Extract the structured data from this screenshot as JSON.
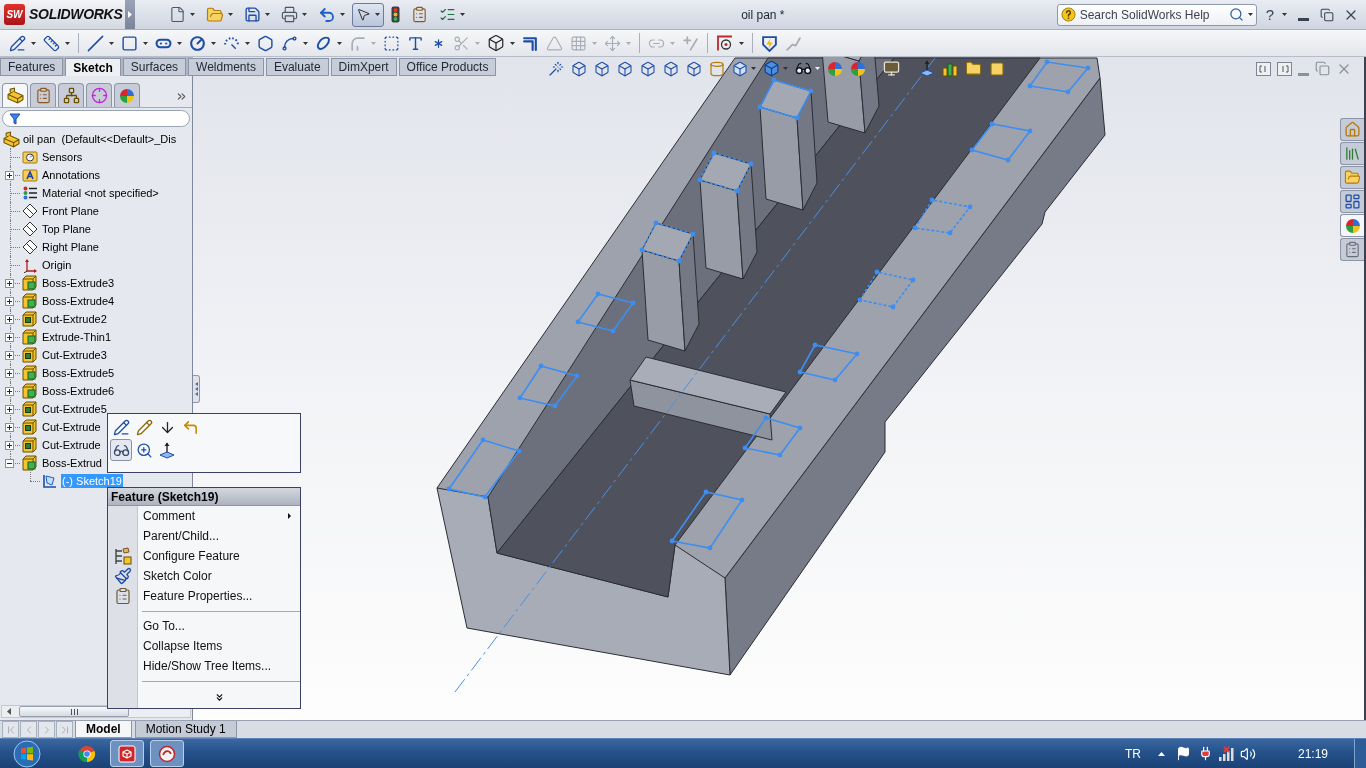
{
  "app": {
    "logo_badge": "SW",
    "logo_text": "SOLIDWORKS",
    "title": "oil pan *",
    "help_button": "?"
  },
  "quick_access": [
    {
      "menu": true,
      "pressed": false
    },
    {
      "menu": true,
      "pressed": false
    },
    {
      "menu": true,
      "pressed": false
    },
    {
      "menu": true,
      "pressed": false
    },
    {
      "menu": true,
      "pressed": false
    },
    {
      "menu": true,
      "pressed": true
    },
    {
      "menu": false,
      "pressed": false
    },
    {
      "menu": false,
      "pressed": false
    },
    {
      "menu": true,
      "pressed": false
    }
  ],
  "help_search": {
    "placeholder": "Search SolidWorks Help"
  },
  "sketch_toolbar": [
    {
      "menu": true,
      "disabled": false
    },
    {
      "menu": true,
      "disabled": false
    },
    {
      "menu": true,
      "disabled": false
    },
    {
      "menu": true,
      "disabled": false
    },
    {
      "menu": true,
      "disabled": false
    },
    {
      "menu": true,
      "disabled": false
    },
    {
      "menu": true,
      "disabled": false
    },
    {
      "menu": false,
      "disabled": false
    },
    {
      "menu": true,
      "disabled": false
    },
    {
      "menu": true,
      "disabled": false
    },
    {
      "menu": true,
      "disabled": true
    },
    {
      "menu": false,
      "disabled": false
    },
    {
      "menu": false,
      "disabled": false
    },
    {
      "menu": false,
      "disabled": false
    },
    {
      "menu": true,
      "disabled": true
    },
    {
      "menu": true,
      "disabled": false
    },
    {
      "menu": false,
      "disabled": false
    },
    {
      "menu": false,
      "disabled": true
    },
    {
      "menu": true,
      "disabled": true
    },
    {
      "menu": true,
      "disabled": true
    },
    {
      "menu": true,
      "disabled": true
    },
    {
      "menu": false,
      "disabled": true
    },
    {
      "menu": true,
      "disabled": false
    },
    {
      "menu": false,
      "disabled": false
    },
    {
      "menu": false,
      "disabled": true
    }
  ],
  "command_tabs": [
    {
      "label": "Features",
      "selected": false
    },
    {
      "label": "Sketch",
      "selected": true
    },
    {
      "label": "Surfaces",
      "selected": false
    },
    {
      "label": "Weldments",
      "selected": false
    },
    {
      "label": "Evaluate",
      "selected": false
    },
    {
      "label": "DimXpert",
      "selected": false
    },
    {
      "label": "Office Products",
      "selected": false
    }
  ],
  "feature_manager": {
    "tabs": [
      {
        "selected": true
      },
      {
        "selected": false
      },
      {
        "selected": false
      },
      {
        "selected": false
      },
      {
        "selected": false
      }
    ],
    "tree": {
      "label": "oil pan  (Default<<Default>_Dis",
      "kind": "part",
      "selected": false,
      "children": [
        {
          "label": "Sensors",
          "kind": "sensors",
          "selected": false
        },
        {
          "label": "Annotations",
          "kind": "annotations",
          "expanded": false,
          "selected": false
        },
        {
          "label": "Material <not specified>",
          "kind": "material",
          "selected": false
        },
        {
          "label": "Front Plane",
          "kind": "plane",
          "selected": false
        },
        {
          "label": "Top Plane",
          "kind": "plane",
          "selected": false
        },
        {
          "label": "Right Plane",
          "kind": "plane",
          "selected": false
        },
        {
          "label": "Origin",
          "kind": "origin",
          "selected": false
        },
        {
          "label": "Boss-Extrude3",
          "kind": "boss",
          "expanded": false,
          "selected": false
        },
        {
          "label": "Boss-Extrude4",
          "kind": "boss",
          "expanded": false,
          "selected": false
        },
        {
          "label": "Cut-Extrude2",
          "kind": "cut",
          "expanded": false,
          "selected": false
        },
        {
          "label": "Extrude-Thin1",
          "kind": "boss",
          "expanded": false,
          "selected": false
        },
        {
          "label": "Cut-Extrude3",
          "kind": "cut",
          "expanded": false,
          "selected": false
        },
        {
          "label": "Boss-Extrude5",
          "kind": "boss",
          "expanded": false,
          "selected": false
        },
        {
          "label": "Boss-Extrude6",
          "kind": "boss",
          "expanded": false,
          "selected": false
        },
        {
          "label": "Cut-Extrude5",
          "kind": "cut",
          "expanded": false,
          "selected": false
        },
        {
          "label": "Cut-Extrude",
          "kind": "cut",
          "expanded": false,
          "selected": false
        },
        {
          "label": "Cut-Extrude",
          "kind": "cut",
          "expanded": false,
          "selected": false
        },
        {
          "label": "Boss-Extrud",
          "kind": "boss",
          "expanded": true,
          "selected": false,
          "children": [
            {
              "label": "(-) Sketch19",
              "kind": "sketch",
              "selected": true
            }
          ]
        }
      ]
    }
  },
  "context_toolbar": [
    {
      "pressed": false
    },
    {
      "pressed": false
    },
    {
      "pressed": false
    },
    {
      "pressed": false
    },
    {
      "pressed": true
    },
    {
      "pressed": false
    },
    {
      "pressed": false
    }
  ],
  "context_menu": {
    "title": "Feature (Sketch19)",
    "items": [
      {
        "kind": "item",
        "label": "Comment",
        "submenu": true
      },
      {
        "kind": "item",
        "label": "Parent/Child...",
        "submenu": false
      },
      {
        "kind": "item",
        "label": "Configure Feature",
        "submenu": false
      },
      {
        "kind": "item",
        "label": "Sketch Color",
        "submenu": false
      },
      {
        "kind": "item",
        "label": "Feature Properties...",
        "submenu": false
      },
      {
        "kind": "separator"
      },
      {
        "kind": "item",
        "label": "Go To...",
        "submenu": false
      },
      {
        "kind": "item",
        "label": "Collapse Items",
        "submenu": false
      },
      {
        "kind": "item",
        "label": "Hide/Show Tree Items...",
        "submenu": false
      },
      {
        "kind": "separator"
      },
      {
        "kind": "more"
      }
    ]
  },
  "task_pane_tabs": [
    {
      "selected": false
    },
    {
      "selected": false
    },
    {
      "selected": false
    },
    {
      "selected": false
    },
    {
      "selected": true
    },
    {
      "selected": false
    }
  ],
  "bottom_tabs": {
    "nav": [
      {
        "disabled": true
      },
      {
        "disabled": true
      },
      {
        "disabled": true
      },
      {
        "disabled": true
      }
    ],
    "tabs": [
      {
        "label": "Model",
        "selected": true
      },
      {
        "label": "Motion Study 1",
        "selected": false
      }
    ]
  },
  "taskbar": {
    "apps": [
      {
        "running": false
      },
      {
        "running": true
      },
      {
        "running": true
      }
    ],
    "language": "TR",
    "clock": "21:19"
  }
}
